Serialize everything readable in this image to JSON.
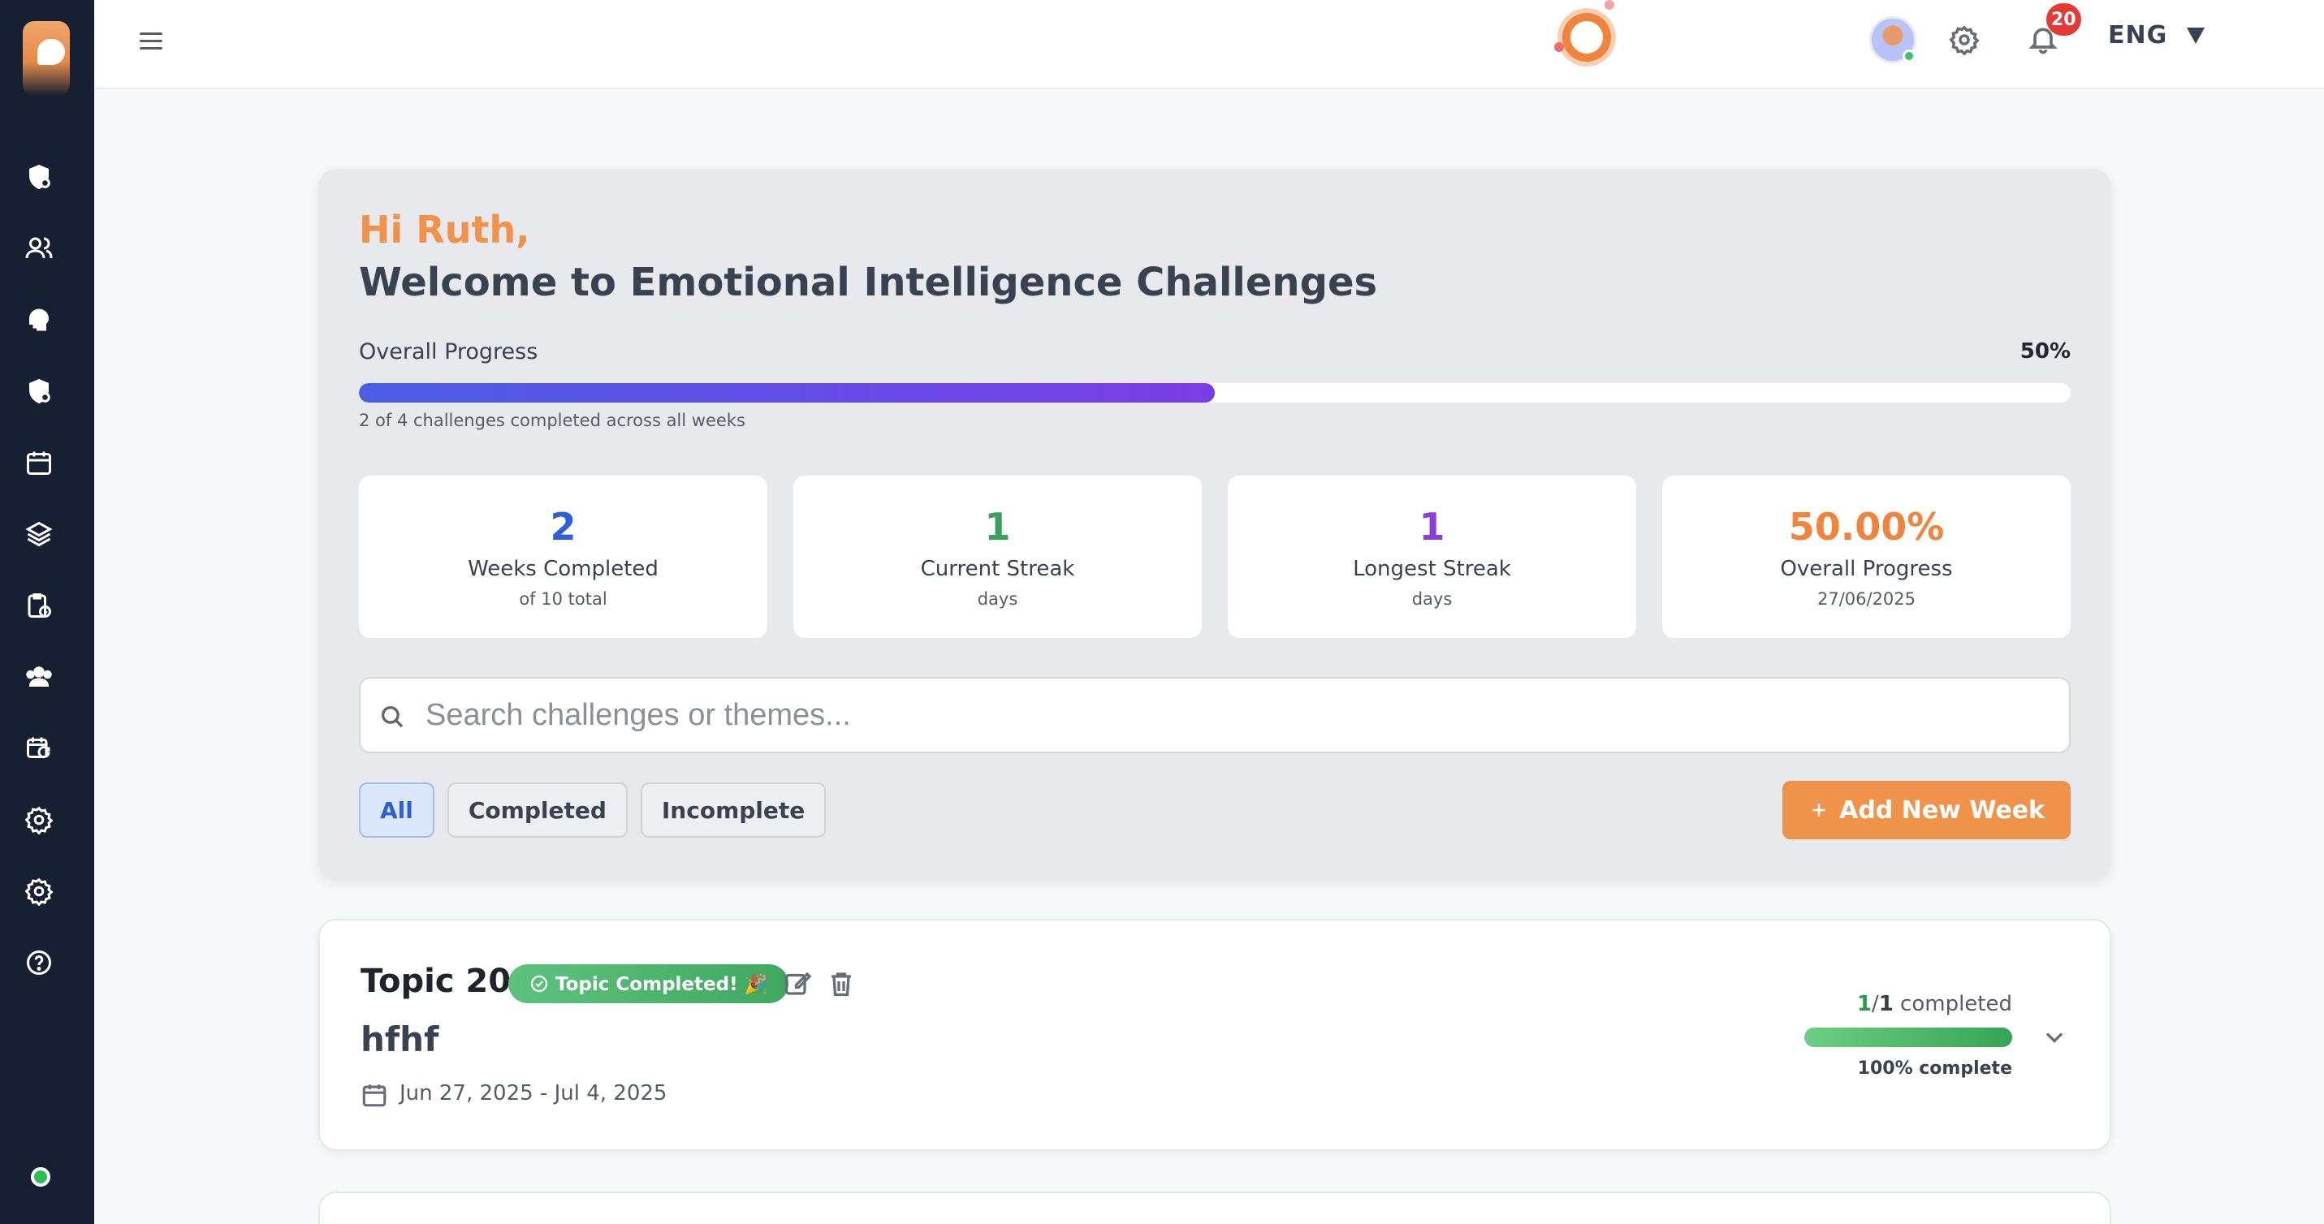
{
  "topbar": {
    "notifications_count": "20",
    "language": "ENG"
  },
  "hero": {
    "greeting": "Hi Ruth,",
    "welcome": "Welcome to Emotional Intelligence Challenges",
    "progress_label": "Overall Progress",
    "progress_percent_text": "50%",
    "progress_fraction": 0.5,
    "progress_subtext": "2 of 4 challenges completed across all weeks"
  },
  "stats": [
    {
      "value": "2",
      "label": "Weeks Completed",
      "sub": "of 10 total",
      "color": "#2f5fd6"
    },
    {
      "value": "1",
      "label": "Current Streak",
      "sub": "days",
      "color": "#3aa05a"
    },
    {
      "value": "1",
      "label": "Longest Streak",
      "sub": "days",
      "color": "#8a3ee0"
    },
    {
      "value": "50.00%",
      "label": "Overall Progress",
      "sub": "27/06/2025",
      "color": "#f0843c"
    }
  ],
  "search": {
    "placeholder": "Search challenges or themes..."
  },
  "filters": {
    "all": "All",
    "completed": "Completed",
    "incomplete": "Incomplete"
  },
  "add_week": {
    "label": "Add New Week"
  },
  "topic": {
    "title": "Topic 20",
    "badge": "Topic Completed! 🎉",
    "subtitle": "hfhf",
    "date_range": "Jun 27, 2025 - Jul 4, 2025",
    "completed_num": "1",
    "completed_total": "1",
    "completed_word": "completed",
    "percent_text": "100% complete",
    "progress_fraction": 1.0
  },
  "colors": {
    "sidebar": "#172033",
    "accent_orange": "#f0924a",
    "progress_blue": "#4a5ee6",
    "progress_purple": "#7b3ce6"
  }
}
